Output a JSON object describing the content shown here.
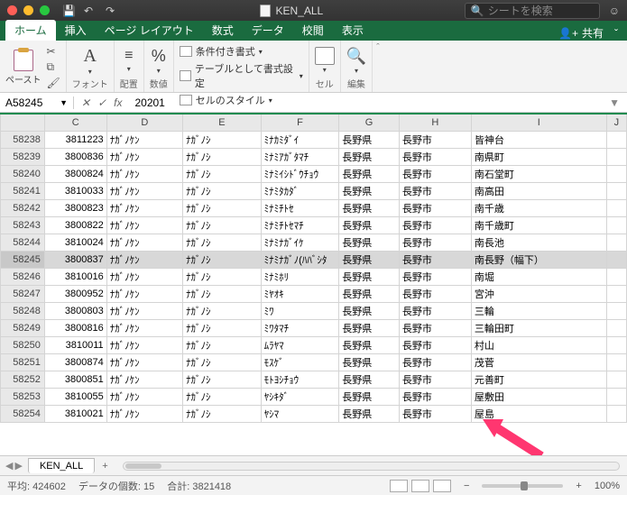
{
  "titlebar": {
    "title": "KEN_ALL",
    "search_placeholder": "シートを検索"
  },
  "tabs": {
    "items": [
      "ホーム",
      "挿入",
      "ページ レイアウト",
      "数式",
      "データ",
      "校閲",
      "表示"
    ],
    "active": 0,
    "share": "共有"
  },
  "ribbon": {
    "paste": "ペースト",
    "font": "フォント",
    "align": "配置",
    "number": "数値",
    "cond1": "条件付き書式",
    "cond2": "テーブルとして書式設定",
    "cond3": "セルのスタイル",
    "cell": "セル",
    "edit": "編集"
  },
  "formula": {
    "name": "A58245",
    "fx": "fx",
    "value": "20201"
  },
  "columns": [
    "C",
    "D",
    "E",
    "F",
    "G",
    "H",
    "I",
    "J"
  ],
  "selected_row": 58245,
  "rows": [
    {
      "n": 58238,
      "c": "3811223",
      "d": "ﾅｶﾞﾉｹﾝ",
      "e": "ﾅｶﾞﾉｼ",
      "f": "ﾐﾅｶﾐﾀﾞｲ",
      "g": "長野県",
      "h": "長野市",
      "i": "皆神台"
    },
    {
      "n": 58239,
      "c": "3800836",
      "d": "ﾅｶﾞﾉｹﾝ",
      "e": "ﾅｶﾞﾉｼ",
      "f": "ﾐﾅﾐｱｶﾞﾀﾏﾁ",
      "g": "長野県",
      "h": "長野市",
      "i": "南県町"
    },
    {
      "n": 58240,
      "c": "3800824",
      "d": "ﾅｶﾞﾉｹﾝ",
      "e": "ﾅｶﾞﾉｼ",
      "f": "ﾐﾅﾐｲｼﾄﾞｳﾁｮｳ",
      "g": "長野県",
      "h": "長野市",
      "i": "南石堂町"
    },
    {
      "n": 58241,
      "c": "3810033",
      "d": "ﾅｶﾞﾉｹﾝ",
      "e": "ﾅｶﾞﾉｼ",
      "f": "ﾐﾅﾐﾀｶﾀﾞ",
      "g": "長野県",
      "h": "長野市",
      "i": "南高田"
    },
    {
      "n": 58242,
      "c": "3800823",
      "d": "ﾅｶﾞﾉｹﾝ",
      "e": "ﾅｶﾞﾉｼ",
      "f": "ﾐﾅﾐﾁﾄｾ",
      "g": "長野県",
      "h": "長野市",
      "i": "南千歳"
    },
    {
      "n": 58243,
      "c": "3800822",
      "d": "ﾅｶﾞﾉｹﾝ",
      "e": "ﾅｶﾞﾉｼ",
      "f": "ﾐﾅﾐﾁﾄｾﾏﾁ",
      "g": "長野県",
      "h": "長野市",
      "i": "南千歳町"
    },
    {
      "n": 58244,
      "c": "3810024",
      "d": "ﾅｶﾞﾉｹﾝ",
      "e": "ﾅｶﾞﾉｼ",
      "f": "ﾐﾅﾐﾅｶﾞｲｹ",
      "g": "長野県",
      "h": "長野市",
      "i": "南長池"
    },
    {
      "n": 58245,
      "c": "3800837",
      "d": "ﾅｶﾞﾉｹﾝ",
      "e": "ﾅｶﾞﾉｼ",
      "f": "ﾐﾅﾐﾅｶﾞﾉ(ﾊﾊﾞｼﾀ",
      "g": "長野県",
      "h": "長野市",
      "i": "南長野（幅下）"
    },
    {
      "n": 58246,
      "c": "3810016",
      "d": "ﾅｶﾞﾉｹﾝ",
      "e": "ﾅｶﾞﾉｼ",
      "f": "ﾐﾅﾐﾎﾘ",
      "g": "長野県",
      "h": "長野市",
      "i": "南堀"
    },
    {
      "n": 58247,
      "c": "3800952",
      "d": "ﾅｶﾞﾉｹﾝ",
      "e": "ﾅｶﾞﾉｼ",
      "f": "ﾐﾔｵｷ",
      "g": "長野県",
      "h": "長野市",
      "i": "宮沖"
    },
    {
      "n": 58248,
      "c": "3800803",
      "d": "ﾅｶﾞﾉｹﾝ",
      "e": "ﾅｶﾞﾉｼ",
      "f": "ﾐﾜ",
      "g": "長野県",
      "h": "長野市",
      "i": "三輪"
    },
    {
      "n": 58249,
      "c": "3800816",
      "d": "ﾅｶﾞﾉｹﾝ",
      "e": "ﾅｶﾞﾉｼ",
      "f": "ﾐﾜﾀﾏﾁ",
      "g": "長野県",
      "h": "長野市",
      "i": "三輪田町"
    },
    {
      "n": 58250,
      "c": "3810011",
      "d": "ﾅｶﾞﾉｹﾝ",
      "e": "ﾅｶﾞﾉｼ",
      "f": "ﾑﾗﾔﾏ",
      "g": "長野県",
      "h": "長野市",
      "i": "村山"
    },
    {
      "n": 58251,
      "c": "3800874",
      "d": "ﾅｶﾞﾉｹﾝ",
      "e": "ﾅｶﾞﾉｼ",
      "f": "ﾓｽｹﾞ",
      "g": "長野県",
      "h": "長野市",
      "i": "茂菅"
    },
    {
      "n": 58252,
      "c": "3800851",
      "d": "ﾅｶﾞﾉｹﾝ",
      "e": "ﾅｶﾞﾉｼ",
      "f": "ﾓﾄﾖｼﾁｮｳ",
      "g": "長野県",
      "h": "長野市",
      "i": "元善町"
    },
    {
      "n": 58253,
      "c": "3810055",
      "d": "ﾅｶﾞﾉｹﾝ",
      "e": "ﾅｶﾞﾉｼ",
      "f": "ﾔｼｷﾀﾞ",
      "g": "長野県",
      "h": "長野市",
      "i": "屋敷田"
    },
    {
      "n": 58254,
      "c": "3810021",
      "d": "ﾅｶﾞﾉｹﾝ",
      "e": "ﾅｶﾞﾉｼ",
      "f": "ﾔｼﾏ",
      "g": "長野県",
      "h": "長野市",
      "i": "屋島"
    }
  ],
  "sheets": {
    "tab": "KEN_ALL"
  },
  "status": {
    "avg_label": "平均:",
    "avg": "424602",
    "count_label": "データの個数:",
    "count": "15",
    "sum_label": "合計:",
    "sum": "3821418",
    "zoom": "100%"
  },
  "chart_data": null
}
